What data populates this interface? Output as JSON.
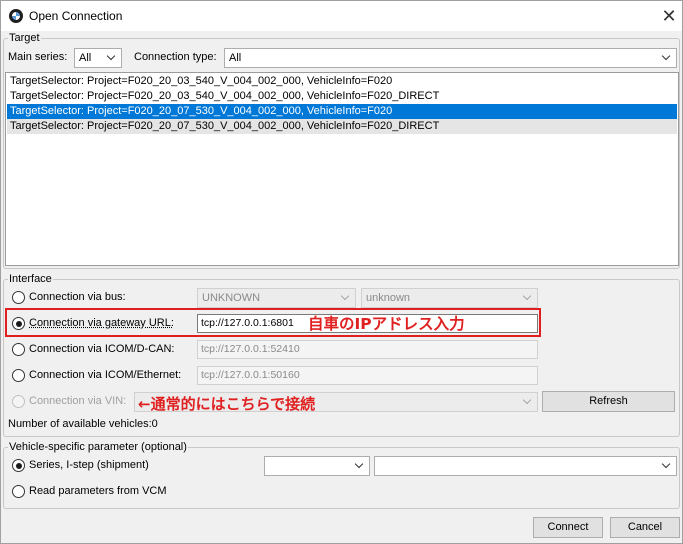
{
  "window": {
    "title": "Open Connection"
  },
  "target": {
    "legend": "Target",
    "main_series_label": "Main series:",
    "main_series_value": "All",
    "connection_type_label": "Connection type:",
    "connection_type_value": "All",
    "list": [
      "TargetSelector: Project=F020_20_03_540_V_004_002_000, VehicleInfo=F020",
      "TargetSelector: Project=F020_20_03_540_V_004_002_000, VehicleInfo=F020_DIRECT",
      "TargetSelector: Project=F020_20_07_530_V_004_002_000, VehicleInfo=F020",
      "TargetSelector: Project=F020_20_07_530_V_004_002_000, VehicleInfo=F020_DIRECT"
    ],
    "selected_index": 2
  },
  "interface": {
    "legend": "Interface",
    "bus_label": "Connection via bus:",
    "bus_value": "UNKNOWN",
    "bus_value2": "unknown",
    "gateway_label": "Connection via gateway URL:",
    "gateway_value": "tcp://127.0.0.1:6801",
    "icom_dcan_label": "Connection via ICOM/D-CAN:",
    "icom_dcan_value": "tcp://127.0.0.1:52410",
    "icom_eth_label": "Connection via ICOM/Ethernet:",
    "icom_eth_value": "tcp://127.0.0.1:50160",
    "vin_label": "Connection via VIN:",
    "vin_value": "",
    "refresh_label": "Refresh",
    "vehicles_count_label": "Number of available vehicles:0"
  },
  "vehicle_params": {
    "legend": "Vehicle-specific parameter (optional)",
    "series_label": "Series, I-step (shipment)",
    "series_value": "",
    "istep_value": "",
    "vcm_label": "Read parameters from VCM"
  },
  "annotations": {
    "gateway_note": "自車のIPアドレス入力",
    "vin_note": "←通常的にはこちらで接続"
  },
  "footer": {
    "connect_label": "Connect",
    "cancel_label": "Cancel"
  },
  "colors": {
    "selection": "#0078d7",
    "annotation": "#e02020"
  }
}
